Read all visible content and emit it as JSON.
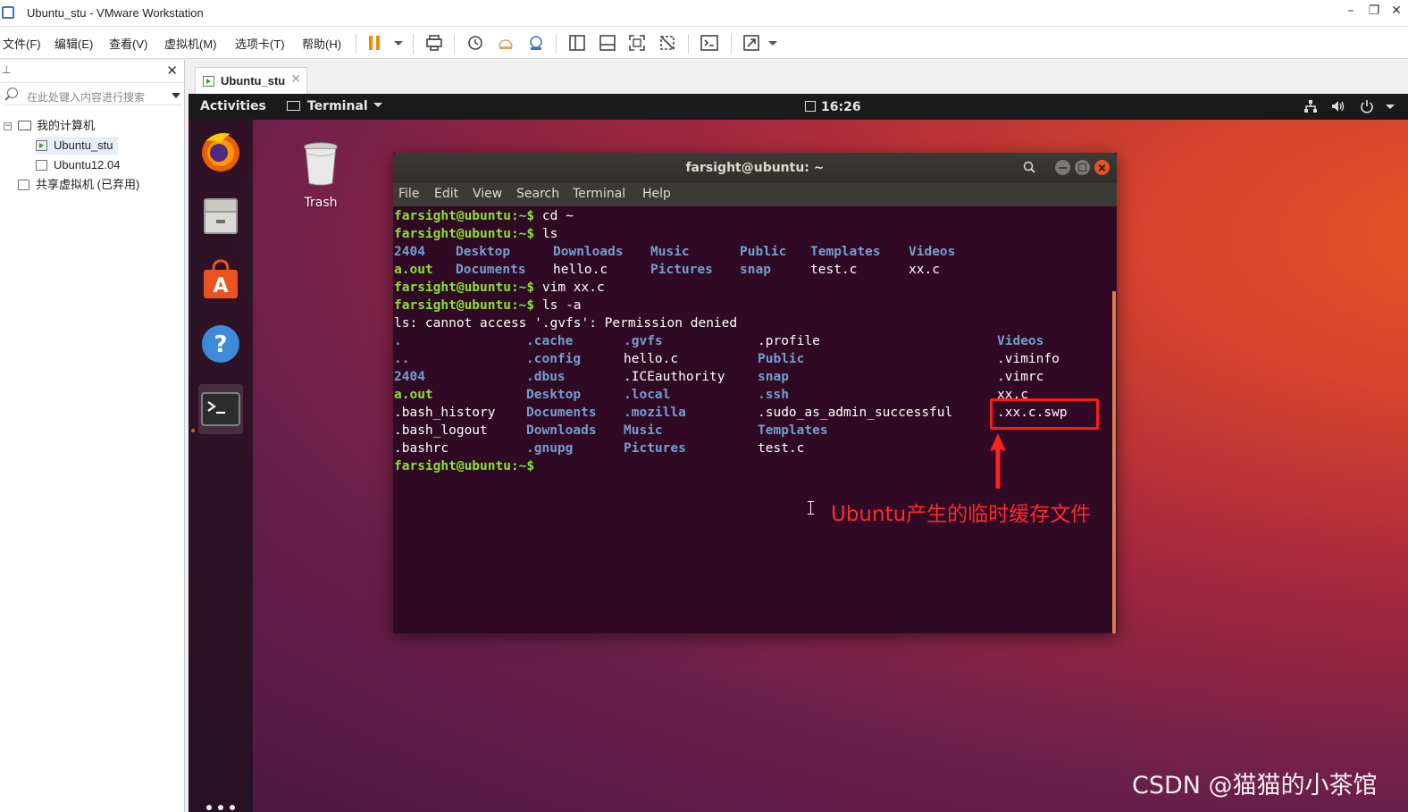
{
  "window": {
    "title": "Ubuntu_stu - VMware Workstation"
  },
  "menu": {
    "items": [
      "文件(F)",
      "编辑(E)",
      "查看(V)",
      "虚拟机(M)",
      "选项卡(T)",
      "帮助(H)"
    ]
  },
  "library": {
    "search_placeholder": "在此处键入内容进行搜索",
    "tree": {
      "root": "我的计算机",
      "vms": [
        "Ubuntu_stu",
        "Ubuntu12.04"
      ],
      "shared": "共享虚拟机 (已弃用)"
    }
  },
  "tab": {
    "label": "Ubuntu_stu"
  },
  "guest": {
    "topbar": {
      "activities": "Activities",
      "app_menu": "Terminal",
      "clock": "16:26"
    },
    "desktop": {
      "trash_label": "Trash"
    }
  },
  "terminal": {
    "title": "farsight@ubuntu: ~",
    "menu": [
      "File",
      "Edit",
      "View",
      "Search",
      "Terminal",
      "Help"
    ],
    "prompt": "farsight@ubuntu:~$",
    "commands": [
      "cd ~",
      "ls",
      "vim xx.c",
      "ls -a"
    ],
    "ls_output": [
      [
        "2404",
        "Desktop",
        "Downloads",
        "Music",
        "Public",
        "Templates",
        "Videos"
      ],
      [
        "a.out",
        "Documents",
        "hello.c",
        "Pictures",
        "snap",
        "test.c",
        "xx.c"
      ]
    ],
    "error_line": "ls: cannot access '.gvfs': Permission denied",
    "ls_a_output": {
      "col1": [
        ".",
        "..",
        "2404",
        "a.out",
        ".bash_history",
        ".bash_logout",
        ".bashrc"
      ],
      "col2": [
        ".cache",
        ".config",
        ".dbus",
        "Desktop",
        "Documents",
        "Downloads",
        ".gnupg"
      ],
      "col3": [
        ".gvfs",
        "hello.c",
        ".ICEauthority",
        ".local",
        ".mozilla",
        "Music",
        "Pictures"
      ],
      "col4": [
        ".profile",
        "Public",
        "snap",
        ".ssh",
        ".sudo_as_admin_successful",
        "Templates",
        "test.c"
      ],
      "col5": [
        "Videos",
        ".viminfo",
        ".vimrc",
        "xx.c",
        ".xx.c.swp"
      ]
    }
  },
  "annotation": {
    "text": "Ubuntu产生的临时缓存文件",
    "color": "#ff2a2a"
  },
  "watermark": "CSDN @猫猫的小茶馆",
  "colors": {
    "prompt": "#8ae234",
    "directory": "#729fcf",
    "terminal_bg": "#300a24",
    "ubuntu_orange": "#e95420"
  }
}
